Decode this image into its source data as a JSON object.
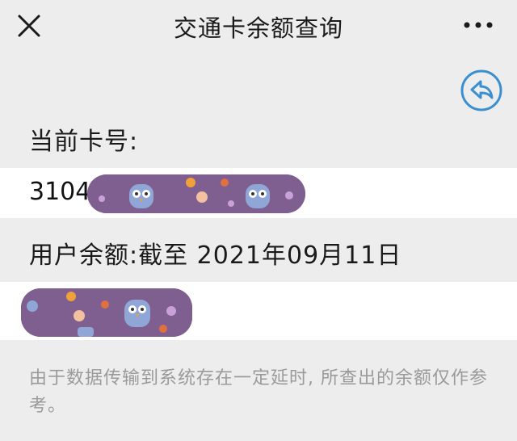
{
  "header": {
    "title": "交通卡余额查询"
  },
  "icons": {
    "close": "close-icon",
    "more": "more-dots-icon",
    "back": "back-arrow-icon"
  },
  "card": {
    "label": "当前卡号:",
    "number_visible": "3104"
  },
  "balance": {
    "label": "用户余额:截至 2021年09月11日"
  },
  "note": {
    "text": "由于数据传输到系统存在一定延时, 所查出的余额仅作参考。"
  },
  "colors": {
    "background": "#ededed",
    "row": "#ffffff",
    "accent": "#3a8fd0",
    "note_text": "#9a9a9a",
    "mask": "#7e5f8f"
  }
}
